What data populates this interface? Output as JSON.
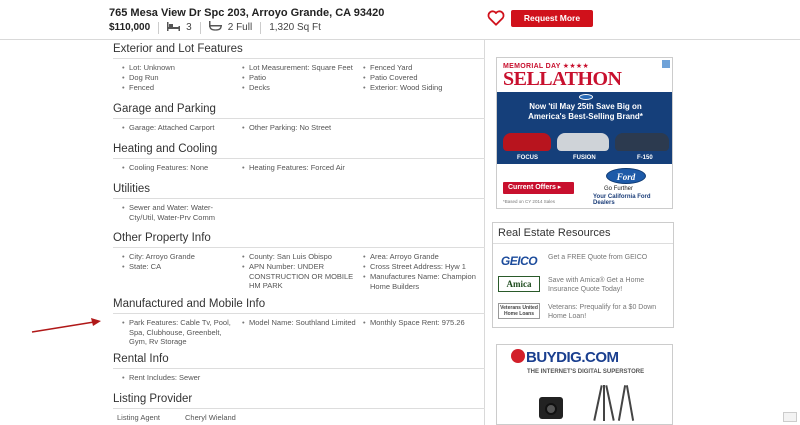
{
  "listing": {
    "address": "765 Mesa View Dr Spc 203, Arroyo Grande, CA 93420",
    "price": "$110,000",
    "beds": "3",
    "baths": "2 Full",
    "sqft": "1,320 Sq Ft",
    "request_button": "Request More Details"
  },
  "sections": {
    "exterior": {
      "title": "Exterior and Lot Features",
      "col1": [
        "Lot: Unknown",
        "Dog Run",
        "Fenced"
      ],
      "col2": [
        "Lot Measurement: Square Feet",
        "Patio",
        "Decks"
      ],
      "col3": [
        "Fenced Yard",
        "Patio Covered",
        "Exterior: Wood Siding"
      ]
    },
    "garage": {
      "title": "Garage and Parking",
      "col1": [
        "Garage: Attached Carport"
      ],
      "col2": [
        "Other Parking: No Street"
      ]
    },
    "heating": {
      "title": "Heating and Cooling",
      "col1": [
        "Cooling Features: None"
      ],
      "col2": [
        "Heating Features: Forced Air"
      ]
    },
    "utilities": {
      "title": "Utilities",
      "col1": [
        "Sewer and Water: Water-Cty/Util, Water-Prv Comm"
      ]
    },
    "other": {
      "title": "Other Property Info",
      "col1": [
        "City: Arroyo Grande",
        "State: CA"
      ],
      "col2": [
        "County: San Luis Obispo",
        "APN Number: UNDER CONSTRUCTION OR MOBILE HM PARK"
      ],
      "col3": [
        "Area: Arroyo Grande",
        "Cross Street Address: Hyw 1",
        "Manufactures Name: Champion Home Builders"
      ]
    },
    "manufactured": {
      "title": "Manufactured and Mobile Info",
      "col1": [
        "Park Features: Cable Tv, Pool, Spa, Clubhouse, Greenbelt, Gym, Rv Storage"
      ],
      "col2": [
        "Model Name: Southland Limited"
      ],
      "col3": [
        "Monthly Space Rent: 975.26"
      ]
    },
    "rental": {
      "title": "Rental Info",
      "col1": [
        "Rent Includes: Sewer"
      ]
    },
    "provider": {
      "title": "Listing Provider",
      "agent_label": "Listing Agent",
      "agent_name": "Cheryl Wieland"
    }
  },
  "ad_ford": {
    "tag": "MEMORIAL DAY ★★★★",
    "headline": "SELLATHON",
    "body": "Now 'til May 25th Save Big on America's Best-Selling Brand*",
    "cars": [
      "FOCUS",
      "FUSION",
      "F-150"
    ],
    "cta": "Current Offers ▸",
    "logo": "Ford",
    "tagline": "Go Further",
    "dealers": "Your California Ford Dealers",
    "footnote": "*Based on CY 2014 Sales"
  },
  "resources": {
    "title": "Real Estate Resources",
    "items": [
      {
        "logo": "GEICO",
        "text": "Get a FREE Quote from GEICO"
      },
      {
        "logo": "Amica",
        "text": "Save with Amica® Get a Home Insurance Quote Today!"
      },
      {
        "logo": "Veterans United Home Loans",
        "text": "Veterans: Prequalify for a $0 Down Home Loan!"
      }
    ]
  },
  "ad_buydig": {
    "brand": "BUYDIG.COM",
    "tagline": "THE INTERNET'S DIGITAL SUPERSTORE"
  },
  "colors": {
    "accent_red": "#d0111b",
    "ford_blue": "#153f7a"
  }
}
